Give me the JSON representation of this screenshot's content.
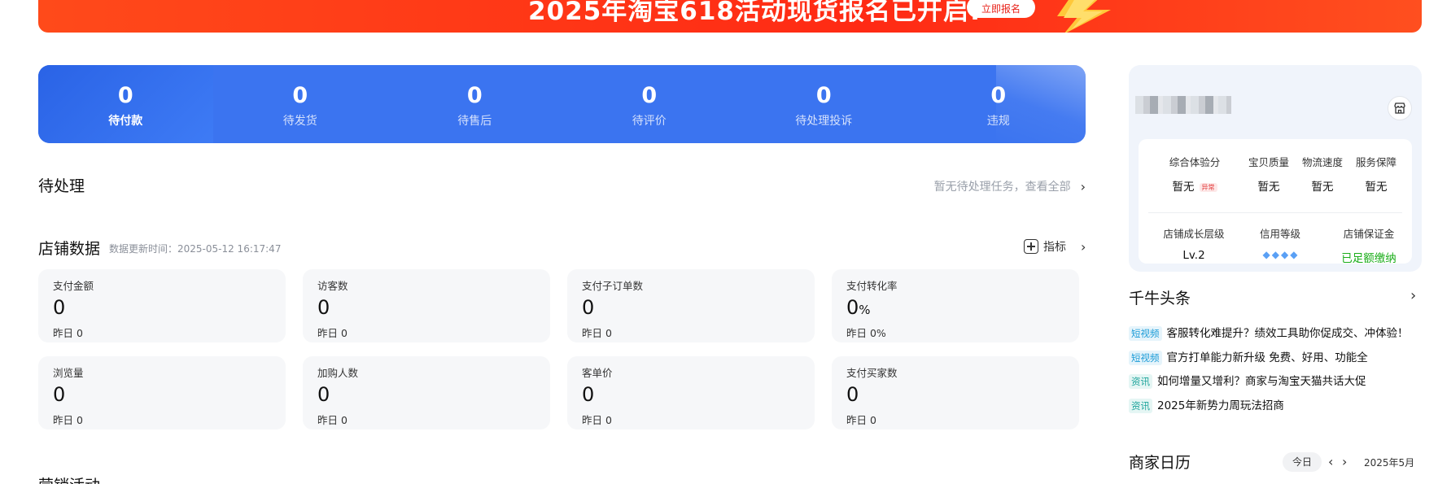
{
  "banner": {
    "title": "2025年淘宝618活动现货报名已开启!",
    "cta_label": "立即报名"
  },
  "orders": [
    {
      "count": "0",
      "label": "待付款",
      "active": true
    },
    {
      "count": "0",
      "label": "待发货"
    },
    {
      "count": "0",
      "label": "待售后"
    },
    {
      "count": "0",
      "label": "待评价"
    },
    {
      "count": "0",
      "label": "待处理投诉"
    },
    {
      "count": "0",
      "label": "违规"
    }
  ],
  "pending": {
    "title": "待处理",
    "link_text": "暂无待处理任务，查看全部"
  },
  "shop_data": {
    "title": "店铺数据",
    "update_time": "数据更新时间：2025-05-12 16:17:47",
    "metrics_link": "指标",
    "cards": [
      {
        "label": "支付金额",
        "value": "0",
        "unit": "",
        "yesterday": "昨日 0"
      },
      {
        "label": "访客数",
        "value": "0",
        "unit": "",
        "yesterday": "昨日 0"
      },
      {
        "label": "支付子订单数",
        "value": "0",
        "unit": "",
        "yesterday": "昨日 0"
      },
      {
        "label": "支付转化率",
        "value": "0",
        "unit": "%",
        "yesterday": "昨日 0%"
      },
      {
        "label": "浏览量",
        "value": "0",
        "unit": "",
        "yesterday": "昨日 0"
      },
      {
        "label": "加购人数",
        "value": "0",
        "unit": "",
        "yesterday": "昨日 0"
      },
      {
        "label": "客单价",
        "value": "0",
        "unit": "",
        "yesterday": "昨日 0"
      },
      {
        "label": "支付买家数",
        "value": "0",
        "unit": "",
        "yesterday": "昨日 0"
      }
    ]
  },
  "marketing": {
    "title": "营销活动"
  },
  "shop_panel": {
    "icon": "store-icon",
    "scores": [
      {
        "label": "综合体验分",
        "value": "暂无",
        "tag": "异常"
      },
      {
        "label": "宝贝质量",
        "value": "暂无"
      },
      {
        "label": "物流速度",
        "value": "暂无"
      },
      {
        "label": "服务保障",
        "value": "暂无"
      }
    ],
    "levels": [
      {
        "label": "店铺成长层级",
        "value": "Lv.2"
      },
      {
        "label": "信用等级",
        "value": "",
        "diamonds": 4
      },
      {
        "label": "店铺保证金",
        "value": "已足额缴纳"
      }
    ]
  },
  "news": {
    "title": "千牛头条",
    "items": [
      {
        "tag": "短视频",
        "tag_type": "video",
        "text": "客服转化难提升？绩效工具助你促成交、冲体验！"
      },
      {
        "tag": "短视频",
        "tag_type": "video",
        "text": "官方打单能力新升级 免费、好用、功能全"
      },
      {
        "tag": "资讯",
        "tag_type": "news",
        "text": "如何增量又增利？商家与淘宝天猫共话大促"
      },
      {
        "tag": "资讯",
        "tag_type": "news",
        "text": "2025年新势力周玩法招商"
      }
    ]
  },
  "calendar": {
    "title": "商家日历",
    "today_label": "今日",
    "month": "2025年5月"
  },
  "colors": {
    "banner_red": "#ff2a14",
    "order_blue": "#3b74f0",
    "success_green": "#1aad19",
    "alert_red": "#e23a3a"
  }
}
